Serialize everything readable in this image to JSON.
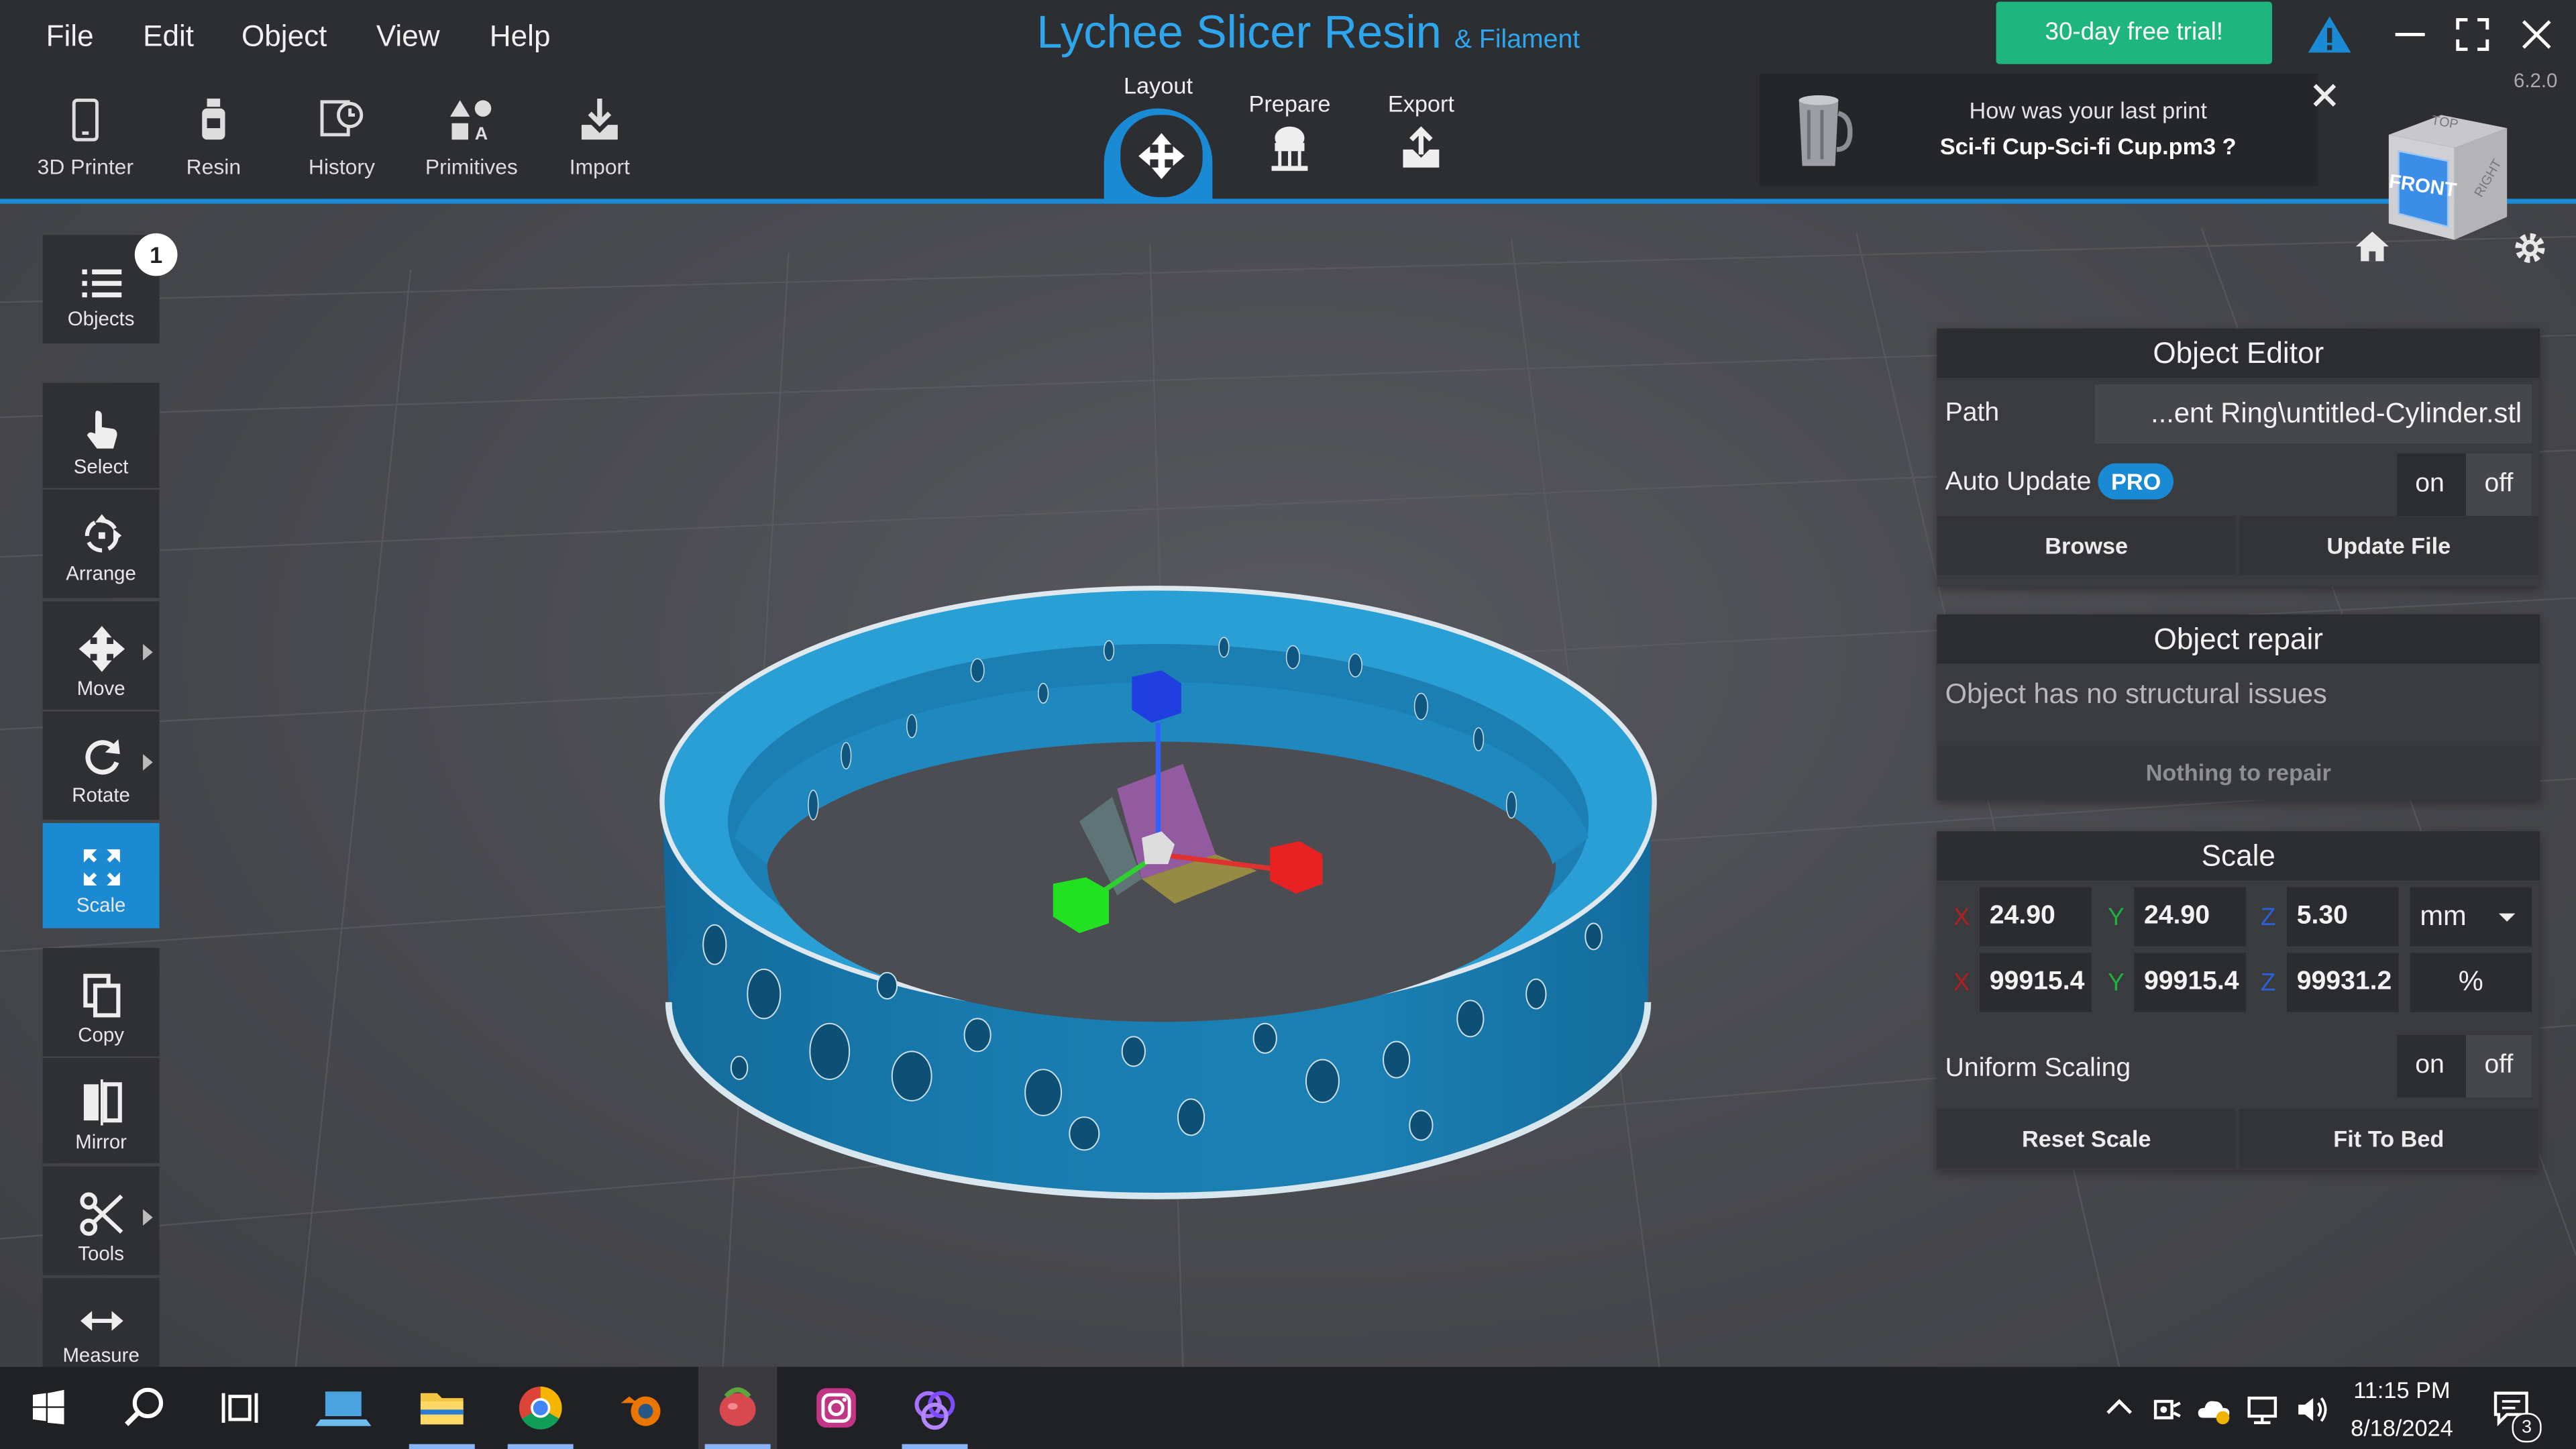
{
  "menu": [
    "File",
    "Edit",
    "Object",
    "View",
    "Help"
  ],
  "title": {
    "main": "Lychee Slicer Resin",
    "sub": "& Filament"
  },
  "version": "6.2.0",
  "trial_button": "30-day free trial!",
  "toolbar": [
    {
      "label": "3D Printer",
      "icon": "phone-printer-icon"
    },
    {
      "label": "Resin",
      "icon": "resin-bottle-icon"
    },
    {
      "label": "History",
      "icon": "history-icon"
    },
    {
      "label": "Primitives",
      "icon": "primitives-icon"
    },
    {
      "label": "Import",
      "icon": "import-icon"
    }
  ],
  "stage_tabs": {
    "layout": "Layout",
    "prepare": "Prepare",
    "export": "Export"
  },
  "feedback": {
    "line1": "How was your last print",
    "line2": "Sci-fi Cup-Sci-fi Cup.pm3 ?"
  },
  "view_cube": {
    "front": "FRONT",
    "right": "RIGHT",
    "top": "TOP"
  },
  "left_tools": {
    "objects": {
      "label": "Objects",
      "badge": "1"
    },
    "select": "Select",
    "arrange": "Arrange",
    "move": "Move",
    "rotate": "Rotate",
    "scale": "Scale",
    "copy": "Copy",
    "mirror": "Mirror",
    "tools": "Tools",
    "measure": "Measure"
  },
  "object_editor": {
    "title": "Object Editor",
    "path_label": "Path",
    "path_value": "...ent Ring\\untitled-Cylinder.stl",
    "auto_update_label": "Auto Update",
    "pro_badge": "PRO",
    "on": "on",
    "off": "off",
    "browse": "Browse",
    "update_file": "Update File"
  },
  "object_repair": {
    "title": "Object repair",
    "status": "Object has no structural issues",
    "button": "Nothing to repair"
  },
  "scale": {
    "title": "Scale",
    "x_label": "X",
    "y_label": "Y",
    "z_label": "Z",
    "x_mm": "24.90",
    "y_mm": "24.90",
    "z_mm": "5.30",
    "unit": "mm",
    "x_pct": "99915.4",
    "y_pct": "99915.4",
    "z_pct": "99931.2",
    "pct_unit": "%",
    "uniform_label": "Uniform Scaling",
    "on": "on",
    "off": "off",
    "reset": "Reset Scale",
    "fit": "Fit To Bed"
  },
  "taskbar": {
    "time": "11:15 PM",
    "date": "8/18/2024",
    "notif_count": "3"
  },
  "colors": {
    "accent": "#1a8ad4",
    "trial": "#1fb57f",
    "ring": "#1b83b8",
    "axis_x": "#e02020",
    "axis_y": "#22cc22",
    "axis_z": "#1f3fe0"
  }
}
